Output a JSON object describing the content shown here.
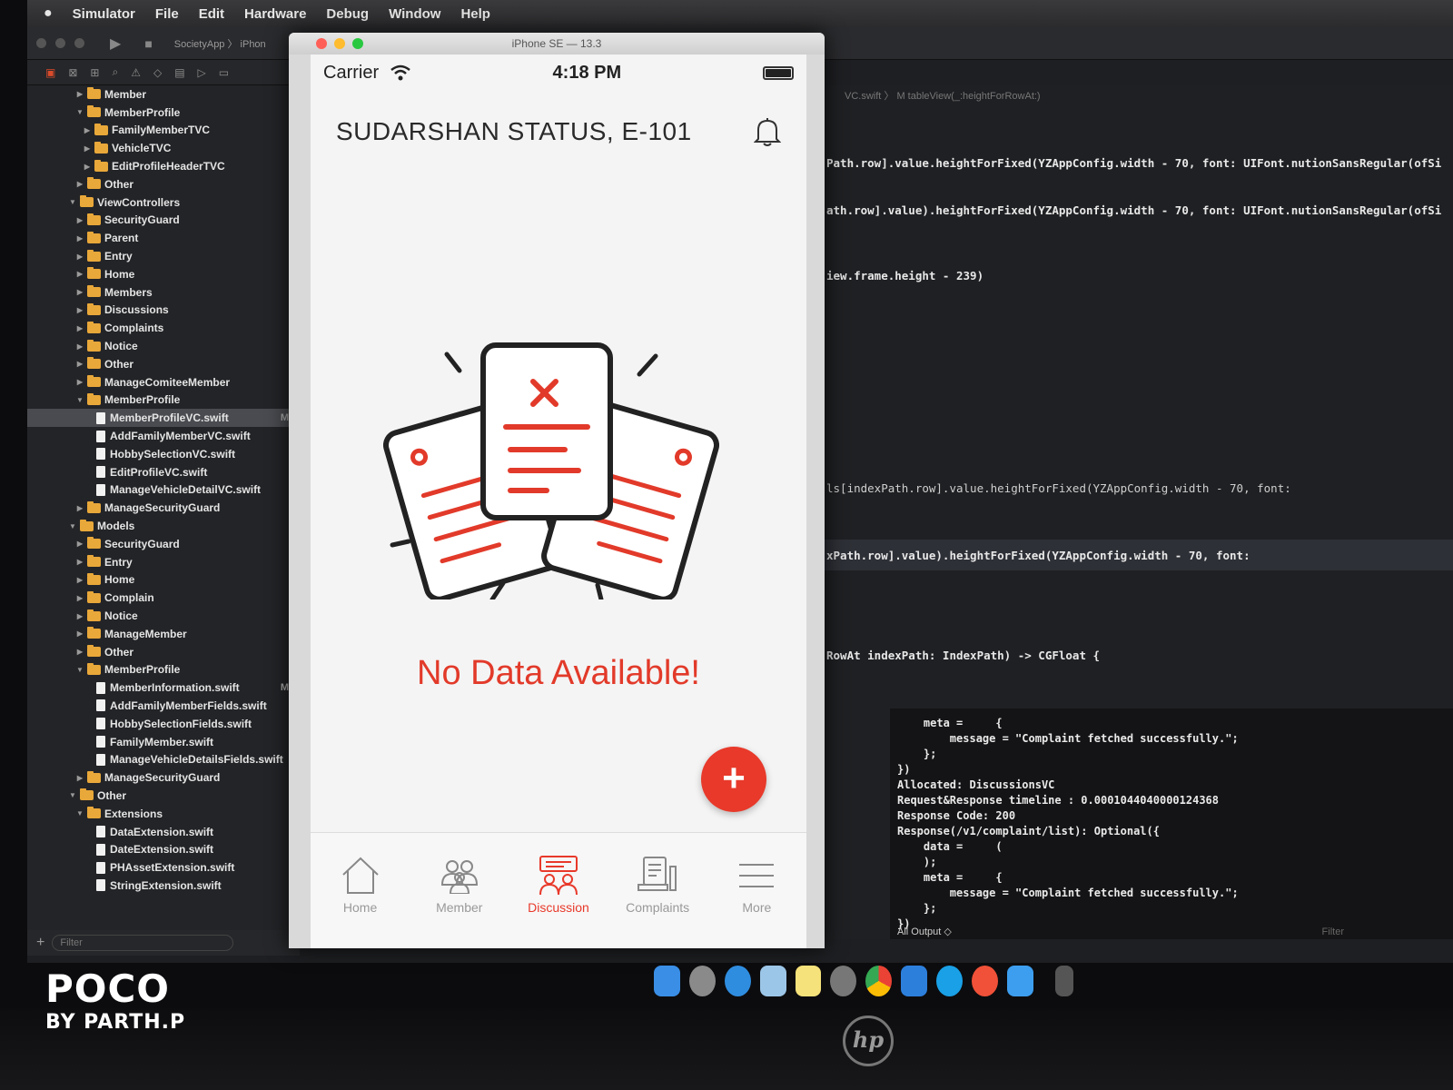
{
  "menubar": {
    "app": "Simulator",
    "items": [
      "File",
      "Edit",
      "Hardware",
      "Debug",
      "Window",
      "Help"
    ]
  },
  "xcode": {
    "scheme": "SocietyApp 〉 iPhon",
    "navigator": [
      {
        "depth": 2,
        "kind": "folder",
        "open": false,
        "label": "Member"
      },
      {
        "depth": 2,
        "kind": "folder",
        "open": true,
        "label": "MemberProfile"
      },
      {
        "depth": 3,
        "kind": "folder",
        "open": false,
        "label": "FamilyMemberTVC"
      },
      {
        "depth": 3,
        "kind": "folder",
        "open": false,
        "label": "VehicleTVC"
      },
      {
        "depth": 3,
        "kind": "folder",
        "open": false,
        "label": "EditProfileHeaderTVC"
      },
      {
        "depth": 2,
        "kind": "folder",
        "open": false,
        "label": "Other"
      },
      {
        "depth": 1,
        "kind": "folder",
        "open": true,
        "label": "ViewControllers"
      },
      {
        "depth": 2,
        "kind": "folder",
        "open": false,
        "label": "SecurityGuard"
      },
      {
        "depth": 2,
        "kind": "folder",
        "open": false,
        "label": "Parent"
      },
      {
        "depth": 2,
        "kind": "folder",
        "open": false,
        "label": "Entry"
      },
      {
        "depth": 2,
        "kind": "folder",
        "open": false,
        "label": "Home"
      },
      {
        "depth": 2,
        "kind": "folder",
        "open": false,
        "label": "Members"
      },
      {
        "depth": 2,
        "kind": "folder",
        "open": false,
        "label": "Discussions"
      },
      {
        "depth": 2,
        "kind": "folder",
        "open": false,
        "label": "Complaints"
      },
      {
        "depth": 2,
        "kind": "folder",
        "open": false,
        "label": "Notice"
      },
      {
        "depth": 2,
        "kind": "folder",
        "open": false,
        "label": "Other"
      },
      {
        "depth": 2,
        "kind": "folder",
        "open": false,
        "label": "ManageComiteeMember"
      },
      {
        "depth": 2,
        "kind": "folder",
        "open": true,
        "label": "MemberProfile"
      },
      {
        "depth": 3,
        "kind": "file",
        "label": "MemberProfileVC.swift",
        "badge": "M",
        "selected": true
      },
      {
        "depth": 3,
        "kind": "file",
        "label": "AddFamilyMemberVC.swift"
      },
      {
        "depth": 3,
        "kind": "file",
        "label": "HobbySelectionVC.swift"
      },
      {
        "depth": 3,
        "kind": "file",
        "label": "EditProfileVC.swift"
      },
      {
        "depth": 3,
        "kind": "file",
        "label": "ManageVehicleDetailVC.swift"
      },
      {
        "depth": 2,
        "kind": "folder",
        "open": false,
        "label": "ManageSecurityGuard"
      },
      {
        "depth": 1,
        "kind": "folder",
        "open": true,
        "label": "Models"
      },
      {
        "depth": 2,
        "kind": "folder",
        "open": false,
        "label": "SecurityGuard"
      },
      {
        "depth": 2,
        "kind": "folder",
        "open": false,
        "label": "Entry"
      },
      {
        "depth": 2,
        "kind": "folder",
        "open": false,
        "label": "Home"
      },
      {
        "depth": 2,
        "kind": "folder",
        "open": false,
        "label": "Complain"
      },
      {
        "depth": 2,
        "kind": "folder",
        "open": false,
        "label": "Notice"
      },
      {
        "depth": 2,
        "kind": "folder",
        "open": false,
        "label": "ManageMember"
      },
      {
        "depth": 2,
        "kind": "folder",
        "open": false,
        "label": "Other"
      },
      {
        "depth": 2,
        "kind": "folder",
        "open": true,
        "label": "MemberProfile"
      },
      {
        "depth": 3,
        "kind": "file",
        "label": "MemberInformation.swift",
        "badge": "M"
      },
      {
        "depth": 3,
        "kind": "file",
        "label": "AddFamilyMemberFields.swift"
      },
      {
        "depth": 3,
        "kind": "file",
        "label": "HobbySelectionFields.swift"
      },
      {
        "depth": 3,
        "kind": "file",
        "label": "FamilyMember.swift"
      },
      {
        "depth": 3,
        "kind": "file",
        "label": "ManageVehicleDetailsFields.swift"
      },
      {
        "depth": 2,
        "kind": "folder",
        "open": false,
        "label": "ManageSecurityGuard"
      },
      {
        "depth": 1,
        "kind": "folder",
        "open": true,
        "label": "Other"
      },
      {
        "depth": 2,
        "kind": "folder",
        "open": true,
        "label": "Extensions"
      },
      {
        "depth": 3,
        "kind": "file",
        "label": "DataExtension.swift"
      },
      {
        "depth": 3,
        "kind": "file",
        "label": "DateExtension.swift"
      },
      {
        "depth": 3,
        "kind": "file",
        "label": "PHAssetExtension.swift"
      },
      {
        "depth": 3,
        "kind": "file",
        "label": "StringExtension.swift"
      }
    ],
    "filter_placeholder": "Filter",
    "jumpbar": "VC.swift 〉 M tableView(_:heightForRowAt:)",
    "code_lines": [
      {
        "text": "Path.row].value.heightForFixed(YZAppConfig.width - 70, font: UIFont.nutionSansRegular(ofSi"
      },
      {
        "text": "ath.row].value).heightForFixed(YZAppConfig.width - 70, font: UIFont.nutionSansRegular(ofSi"
      },
      {
        "text": "iew.frame.height - 239)"
      },
      {
        "text": "ls[indexPath.row].value.heightForFixed(YZAppConfig.width - 70, font:"
      },
      {
        "text": "xPath.row].value).heightForFixed(YZAppConfig.width - 70, font:"
      },
      {
        "text": "RowAt indexPath: IndexPath) -> CGFloat {"
      }
    ],
    "console": "    meta =     {\n        message = \"Complaint fetched successfully.\";\n    };\n})\nAllocated: DiscussionsVC\nRequest&Response timeline : 0.0001044040000124368\nResponse Code: 200\nResponse(/v1/complaint/list): Optional({\n    data =     (\n    );\n    meta =     {\n        message = \"Complaint fetched successfully.\";\n    };\n})",
    "console_output_label": "All Output ◇",
    "console_filter": "Filter"
  },
  "simulator": {
    "window_title": "iPhone SE — 13.3",
    "carrier": "Carrier",
    "time": "4:18 PM",
    "header_title": "SUDARSHAN STATUS, E-101",
    "empty_message": "No Data Available!",
    "fab_label": "+",
    "tabs": [
      {
        "label": "Home",
        "icon": "home-icon"
      },
      {
        "label": "Member",
        "icon": "members-icon"
      },
      {
        "label": "Discussion",
        "icon": "discussion-icon",
        "active": true
      },
      {
        "label": "Complaints",
        "icon": "complaints-icon"
      },
      {
        "label": "More",
        "icon": "menu-icon"
      }
    ],
    "accent": "#e8392a"
  },
  "watermark": {
    "line1": "POCO",
    "line2": "BY PARTH.P"
  },
  "monitor_logo": "hp"
}
